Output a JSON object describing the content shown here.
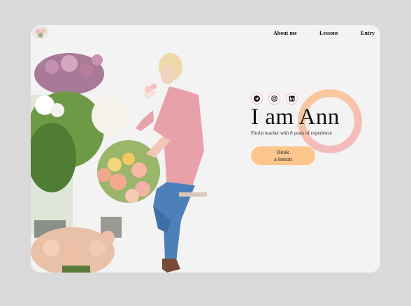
{
  "nav": {
    "about": "About me",
    "lessons": "Lessons",
    "entry": "Entry"
  },
  "hero": {
    "title": "I am Ann",
    "subtitle": "Florist teacher with 8 years of experience",
    "book_line1": "Book",
    "book_line2": "a lesson"
  },
  "socials": [
    "telegram-icon",
    "instagram-icon",
    "linkedin-icon"
  ],
  "colors": {
    "page_bg": "#d9d9d9",
    "card_bg": "#f4f3f4",
    "button": "#fcc68d",
    "ring_start": "#fbcb96",
    "ring_end": "#f2b7c3",
    "social_border": "#f2b9c4"
  }
}
